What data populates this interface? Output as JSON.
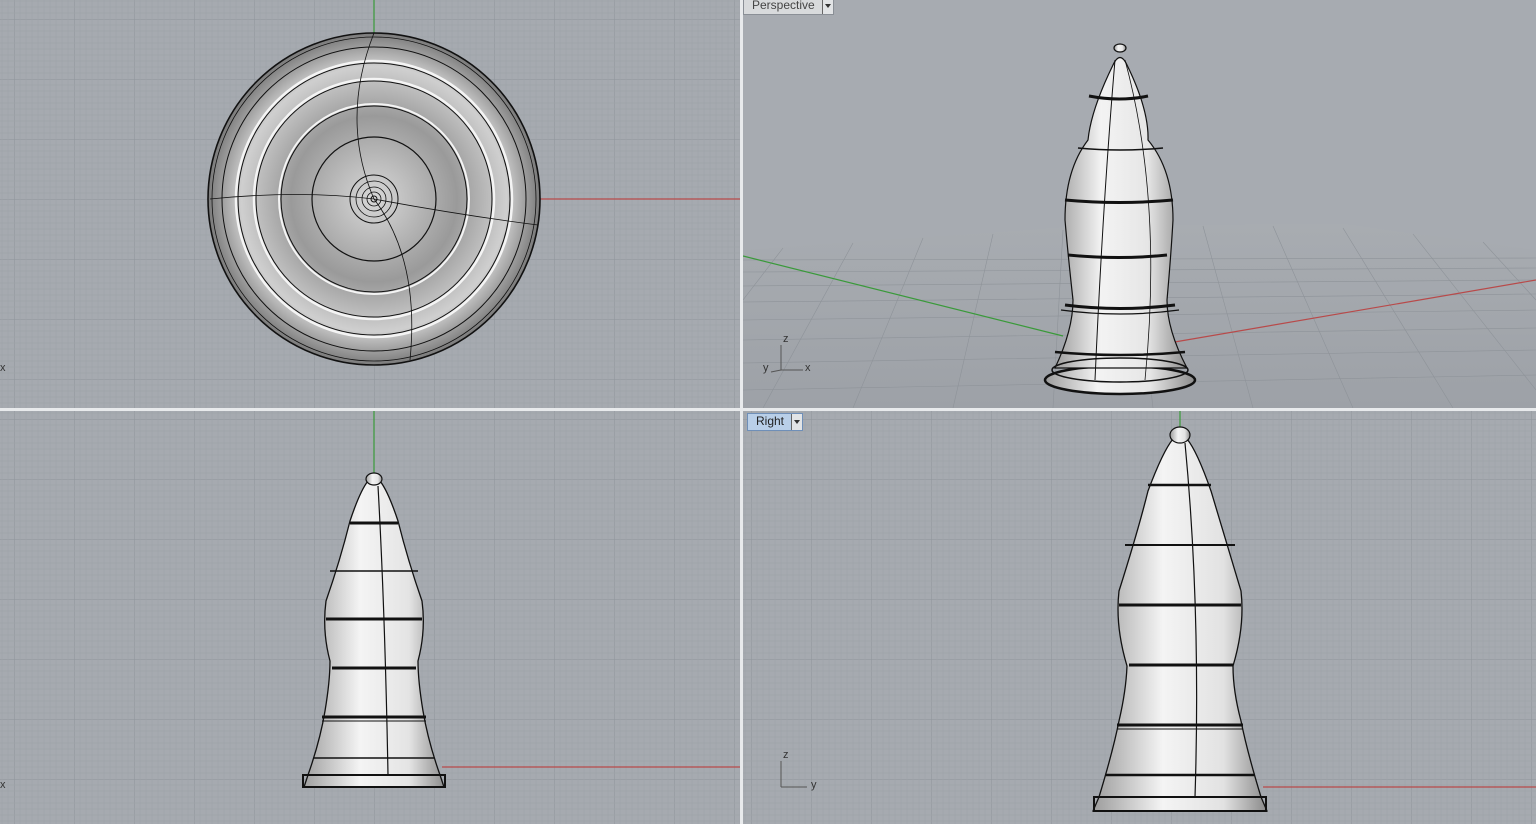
{
  "viewports": {
    "top": {
      "axis_x": "x"
    },
    "perspective": {
      "title": "Perspective",
      "axis_x": "x",
      "axis_y": "y",
      "axis_z": "z"
    },
    "front": {
      "axis_x": "x"
    },
    "right": {
      "title": "Right",
      "axis_y": "y",
      "axis_z": "z"
    }
  },
  "colors": {
    "background": "#a6aab0",
    "grid_minor": "#9ca1a7",
    "grid_major": "#8f949a",
    "axis_x": "#b84a4a",
    "axis_y": "#3a9a3a",
    "model_outline": "#111111"
  },
  "icons": {
    "dropdown": "chevron-down-icon"
  }
}
